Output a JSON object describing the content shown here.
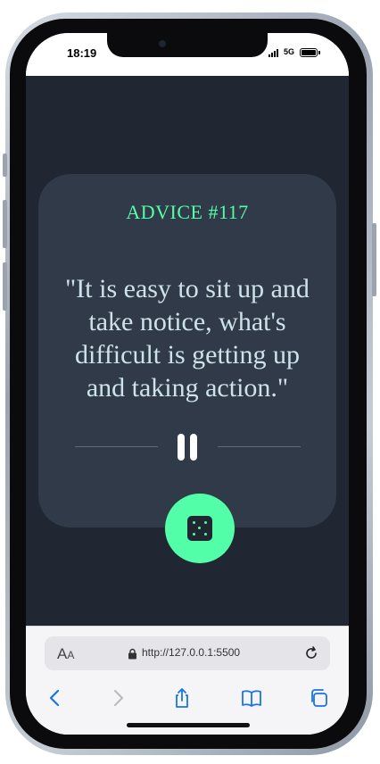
{
  "status_bar": {
    "time": "18:19",
    "network": "5G"
  },
  "advice": {
    "label": "ADVICE #117",
    "quote": "\"It is easy to sit up and take notice, what's difficult is getting up and taking action.\""
  },
  "browser": {
    "text_size_label": "A",
    "text_size_label_small": "A",
    "url": "http://127.0.0.1:5500"
  },
  "icons": [
    "dice-icon",
    "pause-divider-icon",
    "lock-icon",
    "reload-icon",
    "back-icon",
    "forward-icon",
    "share-icon",
    "bookmarks-icon",
    "tabs-icon"
  ],
  "colors": {
    "background": "#202733",
    "card": "#313a48",
    "accent": "#52ffa8",
    "quote_text": "#cee3e9",
    "browser_accent": "#1a73e8"
  }
}
